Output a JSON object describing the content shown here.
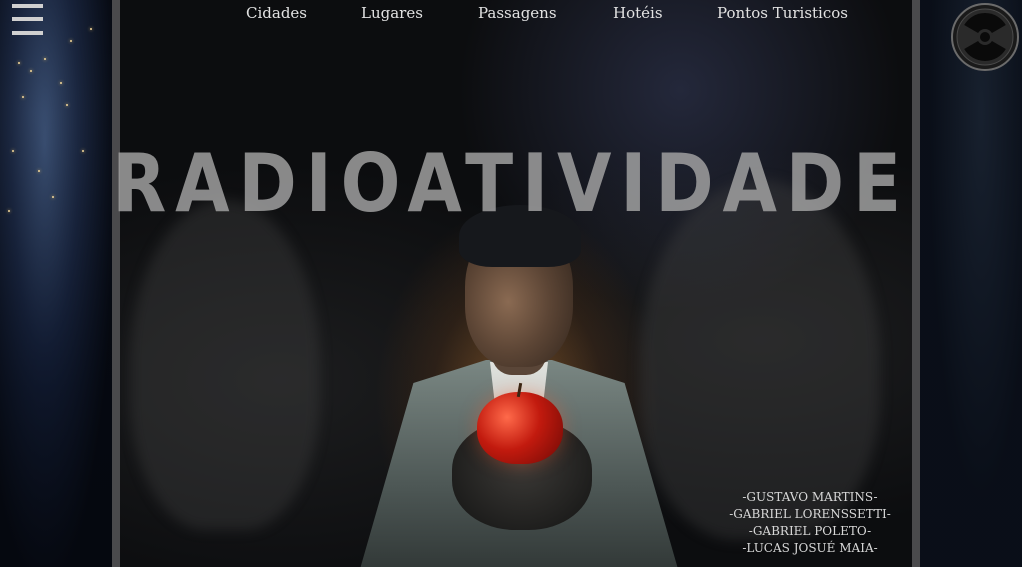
{
  "nav": {
    "items": [
      {
        "label": "Cidades"
      },
      {
        "label": "Lugares"
      },
      {
        "label": "Passagens"
      },
      {
        "label": "Hotéis"
      },
      {
        "label": "Pontos Turisticos"
      }
    ]
  },
  "hero": {
    "title": "RADIOATIVIDADE"
  },
  "credits": [
    "-GUSTAVO MARTINS-",
    "-GABRIEL LORENSSETTI-",
    "-GABRIEL POLETO-",
    "-LUCAS JOSUÉ MAIA-"
  ],
  "icons": {
    "menu": "menu-icon",
    "radioactive": "radioactive-icon"
  },
  "colors": {
    "background": "#05080d",
    "frame": "#4a4a4c",
    "title": "#a5a5a5",
    "nav_text": "#e2e2e2"
  }
}
